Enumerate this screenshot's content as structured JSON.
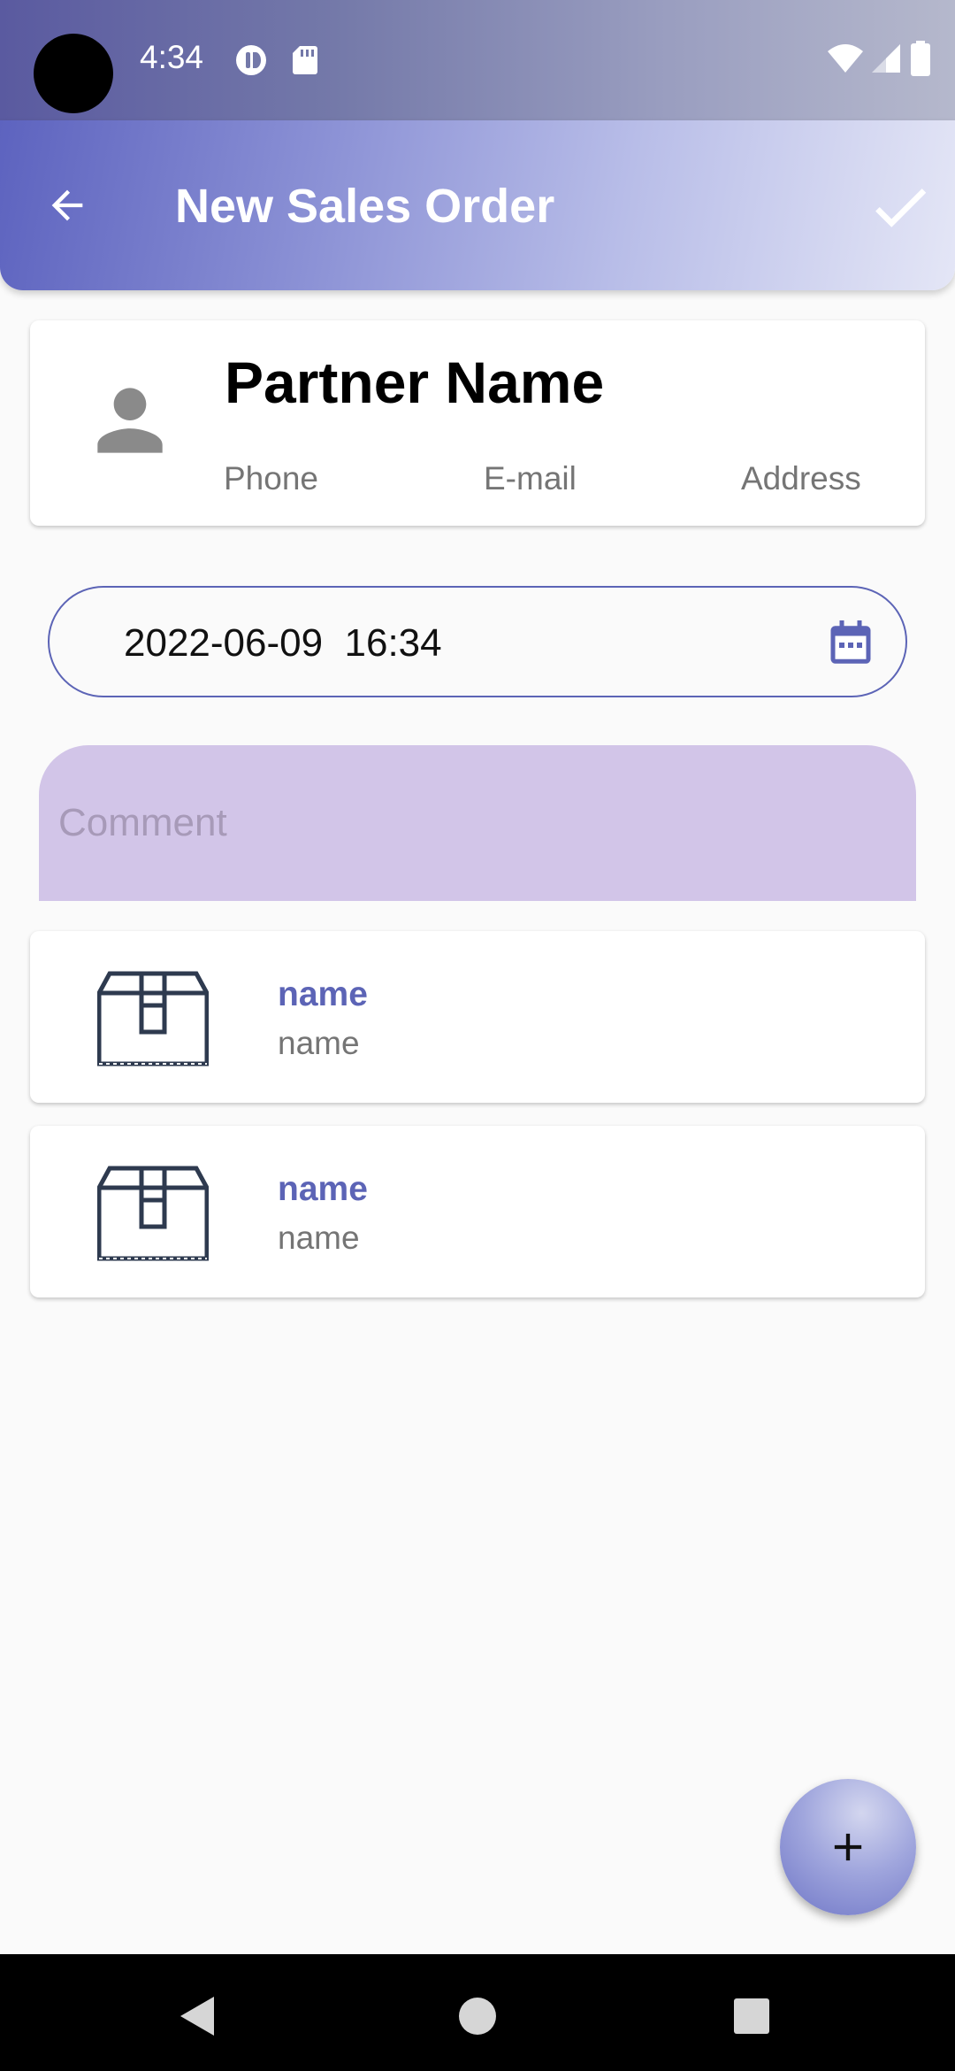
{
  "status_bar": {
    "time": "4:34",
    "icons": [
      "camera-cutout",
      "vpn-key-icon",
      "sd-card-icon",
      "wifi-icon",
      "signal-icon",
      "battery-icon"
    ]
  },
  "app_bar": {
    "title": "New Sales Order",
    "back_icon": "arrow-back-icon",
    "confirm_icon": "check-icon"
  },
  "partner": {
    "name": "Partner Name",
    "avatar_icon": "person-icon",
    "fields": [
      "Phone",
      "E-mail",
      "Address"
    ]
  },
  "date_field": {
    "value": "2022-06-09  16:34",
    "icon": "calendar-icon"
  },
  "comment": {
    "placeholder": "Comment",
    "value": ""
  },
  "items": [
    {
      "title": "name",
      "subtitle": "name",
      "icon": "box-icon"
    },
    {
      "title": "name",
      "subtitle": "name",
      "icon": "box-icon"
    }
  ],
  "fab": {
    "icon": "plus-icon"
  },
  "nav": {
    "buttons": [
      "back",
      "home",
      "recents"
    ]
  },
  "colors": {
    "primary": "#5c64b6",
    "comment_bg": "#d2c5e8",
    "comment_placeholder": "#a79ab8",
    "background": "#fafafa"
  }
}
